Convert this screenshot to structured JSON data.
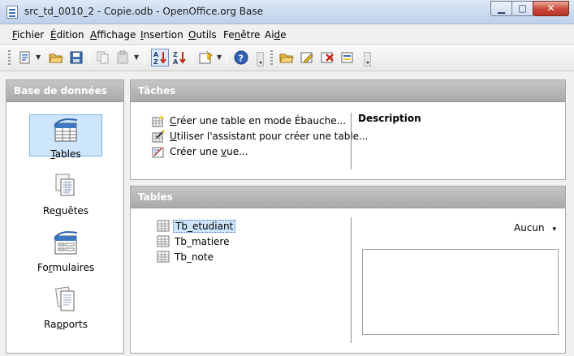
{
  "window": {
    "title": "src_td_0010_2 - Copie.odb - OpenOffice.org Base",
    "minimize_glyph": "▁",
    "maximize_glyph": "▢",
    "close_glyph": "✕"
  },
  "menu": [
    {
      "label": "Fichier",
      "key": "F",
      "rest": "ichier"
    },
    {
      "label": "Édition",
      "key": "É",
      "rest": "dition"
    },
    {
      "label": "Affichage",
      "key": "A",
      "rest": "ffichage"
    },
    {
      "label": "Insertion",
      "key": "I",
      "rest": "nsertion"
    },
    {
      "label": "Outils",
      "key": "O",
      "rest": "utils"
    },
    {
      "label": "Fenêtre",
      "pre": "Fe",
      "key": "n",
      "rest": "être"
    },
    {
      "label": "Aide",
      "pre": "Ai",
      "key": "d",
      "rest": "e"
    }
  ],
  "left_panel": {
    "header": "Base de données",
    "items": [
      {
        "label": "Tables",
        "pre": "",
        "key": "T",
        "rest": "ables",
        "selected": true
      },
      {
        "label": "Requêtes",
        "pre": "Re",
        "key": "q",
        "rest": "uêtes",
        "selected": false
      },
      {
        "label": "Formulaires",
        "pre": "Fo",
        "key": "r",
        "rest": "mulaires",
        "selected": false
      },
      {
        "label": "Rapports",
        "pre": "Ra",
        "key": "p",
        "rest": "ports",
        "selected": false
      }
    ]
  },
  "tasks_panel": {
    "header": "Tâches",
    "description_label": "Description",
    "tasks": [
      {
        "pre": "",
        "key": "C",
        "rest": "réer une table en mode Ébauche..."
      },
      {
        "pre": "",
        "key": "U",
        "rest": "tiliser l'assistant pour créer une table..."
      },
      {
        "pre": "Créer une ",
        "key": "v",
        "rest": "ue..."
      }
    ]
  },
  "tables_panel": {
    "header": "Tables",
    "tables": [
      "Tb_etudiant",
      "Tb_matiere",
      "Tb_note"
    ],
    "selected_index": 0,
    "preview_mode": "Aucun",
    "preview_arrow": "▾"
  },
  "colors": {
    "header_bg": "#b0b0b0",
    "selection_bg": "#cde6fb",
    "selection_border": "#7fb3e3"
  }
}
